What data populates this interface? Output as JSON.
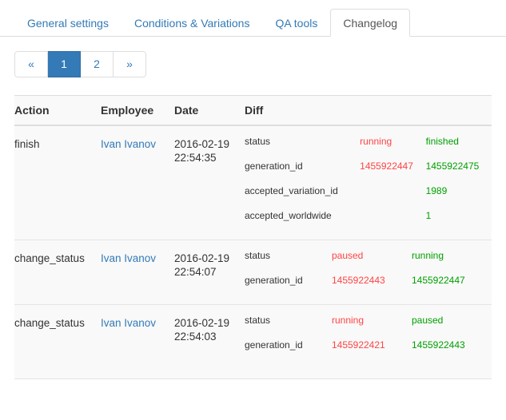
{
  "tabs": [
    {
      "label": "General settings",
      "active": false
    },
    {
      "label": "Conditions & Variations",
      "active": false
    },
    {
      "label": "QA tools",
      "active": false
    },
    {
      "label": "Changelog",
      "active": true
    }
  ],
  "pagination": {
    "prev_label": "«",
    "next_label": "»",
    "pages": [
      "1",
      "2"
    ],
    "current": "1"
  },
  "table": {
    "headers": {
      "action": "Action",
      "employee": "Employee",
      "date": "Date",
      "diff": "Diff"
    },
    "rows": [
      {
        "action": "finish",
        "employee": "Ivan Ivanov",
        "date": "2016-02-19 22:54:35",
        "diff": [
          {
            "key": "status",
            "old": "running",
            "new": "finished"
          },
          {
            "key": "generation_id",
            "old": "1455922447",
            "new": "1455922475"
          },
          {
            "key": "accepted_variation_id",
            "old": "",
            "new": "1989"
          },
          {
            "key": "accepted_worldwide",
            "old": "",
            "new": "1"
          }
        ]
      },
      {
        "action": "change_status",
        "employee": "Ivan Ivanov",
        "date": "2016-02-19 22:54:07",
        "diff": [
          {
            "key": "status",
            "old": "paused",
            "new": "running"
          },
          {
            "key": "generation_id",
            "old": "1455922443",
            "new": "1455922447"
          }
        ]
      },
      {
        "action": "change_status",
        "employee": "Ivan Ivanov",
        "date": "2016-02-19 22:54:03",
        "diff": [
          {
            "key": "status",
            "old": "running",
            "new": "paused"
          },
          {
            "key": "generation_id",
            "old": "1455922421",
            "new": "1455922443"
          }
        ]
      }
    ]
  },
  "colors": {
    "link": "#337ab7",
    "active_page_bg": "#337ab7",
    "diff_old": "#ff4444",
    "diff_new": "#00a000",
    "table_bg": "#f9f9f9",
    "border": "#dddddd"
  }
}
